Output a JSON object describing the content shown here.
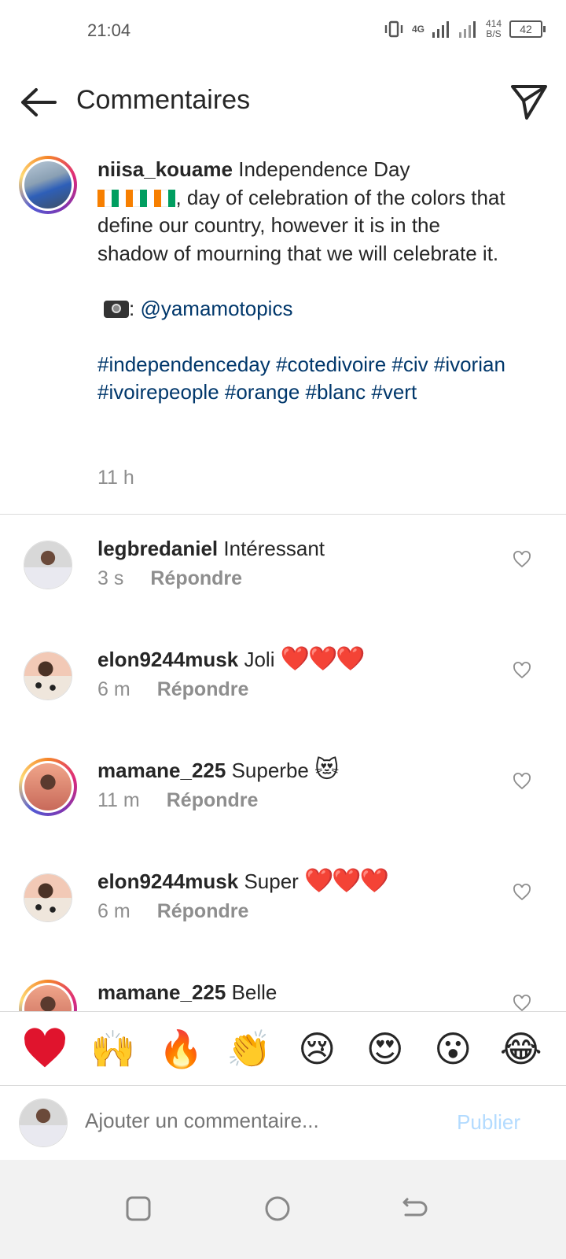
{
  "status": {
    "time": "21:04",
    "network": "4G",
    "speed_value": "414",
    "speed_unit": "B/S",
    "battery": "42"
  },
  "header": {
    "title": "Commentaires"
  },
  "caption": {
    "username": "niisa_kouame",
    "line1": "Independence Day",
    "line2": ", day of celebration of the colors that define our country, however it is in the shadow of mourning that we will celebrate it.",
    "photo_credit_prefix": ": ",
    "photo_credit": "@yamamotopics",
    "hashtags": "#independenceday #cotedivoire #civ #ivorian #ivoirepeople #orange #blanc #vert",
    "time": "11 h"
  },
  "comments": [
    {
      "username": "legbredaniel",
      "text": "Intéressant",
      "emoji": "",
      "time": "3 s",
      "reply": "Répondre"
    },
    {
      "username": "elon9244musk",
      "text": "Joli",
      "emoji": "❤️❤️❤️",
      "time": "6 m",
      "reply": "Répondre"
    },
    {
      "username": "mamane_225",
      "text": "Superbe",
      "emoji": "😻",
      "time": "11 m",
      "reply": "Répondre"
    },
    {
      "username": "elon9244musk",
      "text": "Super",
      "emoji": "❤️❤️❤️",
      "time": "6 m",
      "reply": "Répondre"
    },
    {
      "username": "mamane_225",
      "text": "Belle",
      "emoji": "",
      "time": "",
      "reply": ""
    }
  ],
  "reactions": [
    "❤️",
    "🙌",
    "🔥",
    "👏",
    "😢",
    "😍",
    "😮",
    "😂"
  ],
  "composer": {
    "placeholder": "Ajouter un commentaire...",
    "publish": "Publier"
  },
  "colors": {
    "link": "#00376b",
    "muted": "#8e8e8e",
    "publish_disabled": "#b3dbff"
  }
}
